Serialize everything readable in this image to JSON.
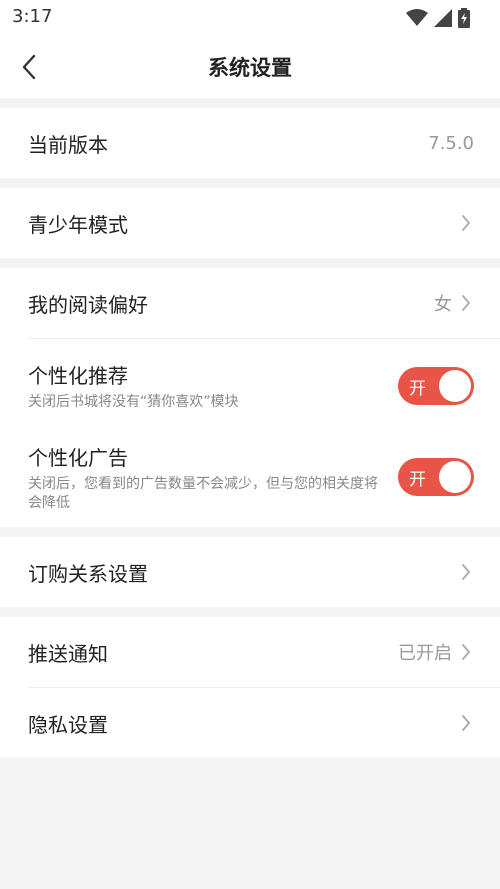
{
  "status_bar": {
    "time": "3:17"
  },
  "header": {
    "title": "系统设置"
  },
  "rows": {
    "version": {
      "label": "当前版本",
      "value": "7.5.0"
    },
    "youth_mode": {
      "label": "青少年模式"
    },
    "reading_pref": {
      "label": "我的阅读偏好",
      "value": "女"
    },
    "personal_rec": {
      "label": "个性化推荐",
      "sub": "关闭后书城将没有“猜你喜欢”模块",
      "toggle": "开"
    },
    "personal_ad": {
      "label": "个性化广告",
      "sub": "关闭后，您看到的广告数量不会减少，但与您的相关度将会降低",
      "toggle": "开"
    },
    "subscription": {
      "label": "订购关系设置"
    },
    "push": {
      "label": "推送通知",
      "value": "已开启"
    },
    "privacy": {
      "label": "隐私设置"
    }
  },
  "colors": {
    "accent": "#e85546",
    "background": "#f4f4f4"
  }
}
